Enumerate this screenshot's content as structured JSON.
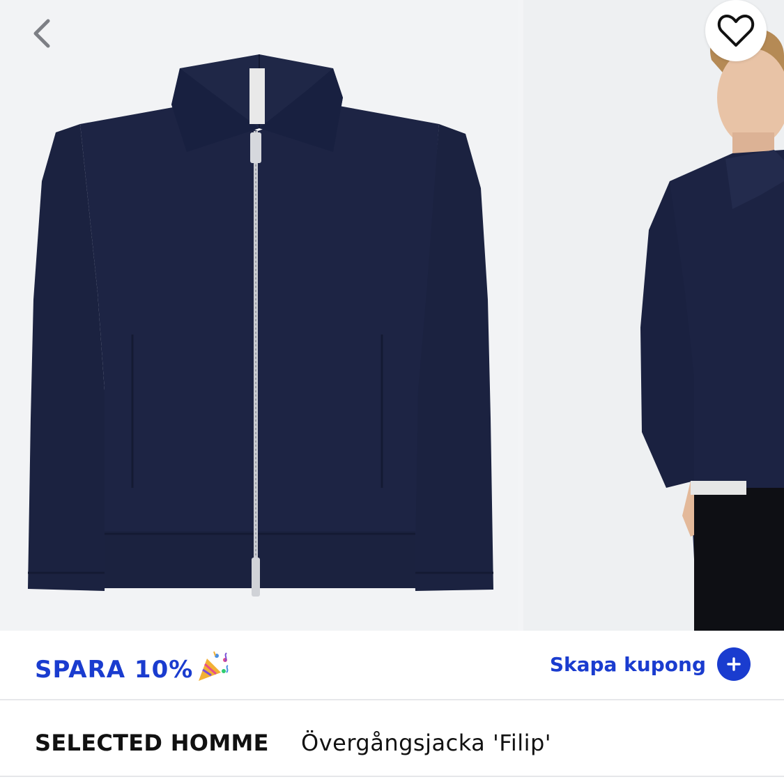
{
  "header": {
    "back_icon": "chevron-left-icon",
    "favorite_icon": "heart-outline-icon"
  },
  "gallery": {
    "images": [
      {
        "label": "product-flatlay",
        "description": ""
      },
      {
        "label": "model-photo",
        "description": ""
      }
    ]
  },
  "promo": {
    "text": "SPARA 10%",
    "icon": "party-popper-icon",
    "coupon_label": "Skapa kupong",
    "coupon_icon": "plus-icon",
    "accent_color": "#1a3ccf"
  },
  "product": {
    "brand": "SELECTED HOMME",
    "name": "Övergångsjacka 'Filip'"
  }
}
